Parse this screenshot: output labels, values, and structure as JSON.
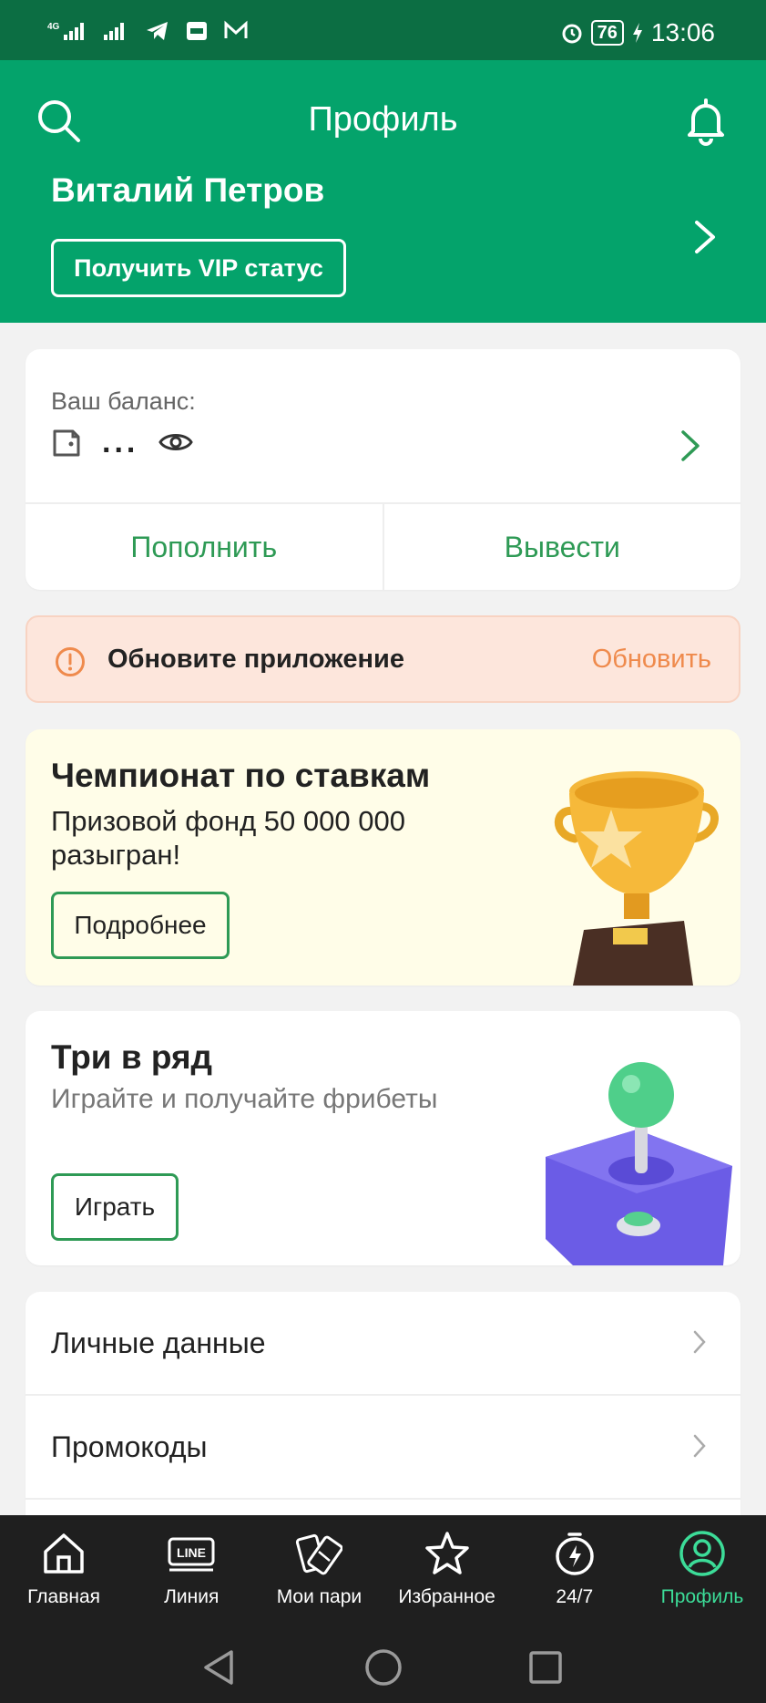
{
  "status_bar": {
    "network": "4G",
    "battery": "76",
    "time": "13:06"
  },
  "header": {
    "title": "Профиль",
    "search_icon": "search-icon",
    "bell_icon": "bell-icon",
    "user_name": "Виталий Петров",
    "vip_button": "Получить VIP статус",
    "bg_color": "#04a36b"
  },
  "balance": {
    "label": "Ваш баланс:",
    "value": "...",
    "deposit_button": "Пополнить",
    "withdraw_button": "Вывести"
  },
  "update_banner": {
    "text": "Обновите приложение",
    "action": "Обновить"
  },
  "promo": {
    "title": "Чемпионат по ставкам",
    "subtitle": "Призовой фонд 50 000 000 разыгран!",
    "button": "Подробнее"
  },
  "game": {
    "title": "Три в ряд",
    "subtitle": "Играйте и получайте фрибеты",
    "button": "Играть"
  },
  "menu": {
    "items": [
      {
        "label": "Личные данные"
      },
      {
        "label": "Промокоды"
      }
    ]
  },
  "tabbar": {
    "tabs": [
      {
        "label": "Главная",
        "icon": "home-icon"
      },
      {
        "label": "Линия",
        "icon": "line-icon"
      },
      {
        "label": "Мои пари",
        "icon": "tickets-icon"
      },
      {
        "label": "Избранное",
        "icon": "star-icon"
      },
      {
        "label": "24/7",
        "icon": "stopwatch-icon"
      },
      {
        "label": "Профиль",
        "icon": "profile-icon",
        "active": true
      }
    ],
    "line_badge": "LINE"
  },
  "colors": {
    "accent_green": "#2e9a55",
    "active_tab": "#3cdc98",
    "warning_orange": "#ef8a4c"
  }
}
